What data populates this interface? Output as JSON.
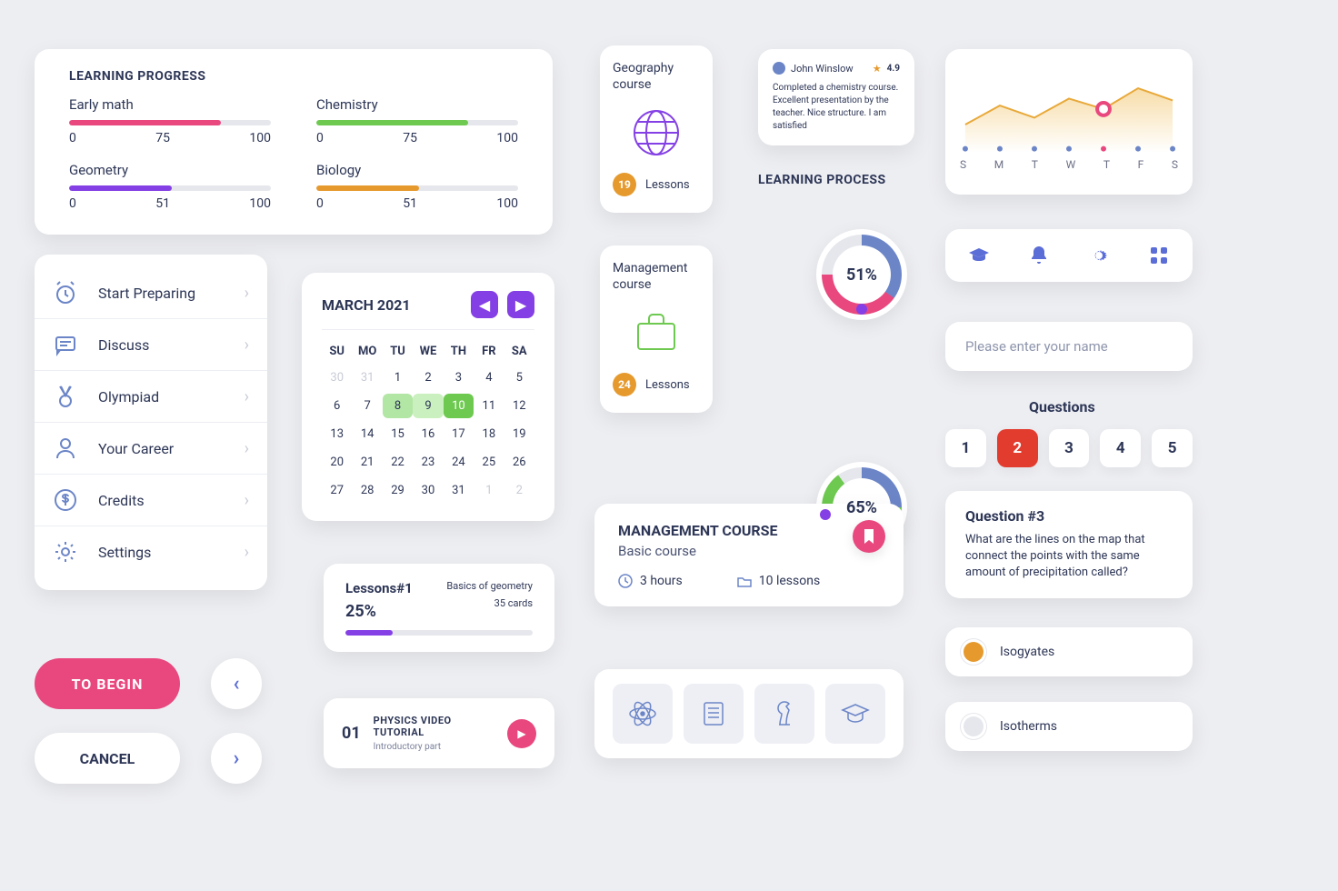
{
  "learning_progress": {
    "title": "LEARNING PROGRESS",
    "items": [
      {
        "label": "Early math",
        "value": 75,
        "min": 0,
        "max": 100,
        "color": "#e8487e"
      },
      {
        "label": "Chemistry",
        "value": 75,
        "min": 0,
        "max": 100,
        "color": "#6dc94f"
      },
      {
        "label": "Geometry",
        "value": 51,
        "min": 0,
        "max": 100,
        "color": "#8440e5"
      },
      {
        "label": "Biology",
        "value": 51,
        "min": 0,
        "max": 100,
        "color": "#e69a2e"
      }
    ]
  },
  "nav": {
    "items": [
      {
        "label": "Start Preparing",
        "icon": "alarm-icon"
      },
      {
        "label": "Discuss",
        "icon": "chat-icon"
      },
      {
        "label": "Olympiad",
        "icon": "medal-icon"
      },
      {
        "label": "Your Career",
        "icon": "person-icon"
      },
      {
        "label": "Credits",
        "icon": "dollar-icon"
      },
      {
        "label": "Settings",
        "icon": "gear-icon"
      }
    ]
  },
  "buttons": {
    "begin": "TO BEGIN",
    "cancel": "CANCEL"
  },
  "calendar": {
    "title": "MARCH 2021",
    "dow": [
      "SU",
      "MO",
      "TU",
      "WE",
      "TH",
      "FR",
      "SA"
    ],
    "prev_month": [
      30,
      31
    ],
    "days": [
      1,
      2,
      3,
      4,
      5,
      6,
      7,
      8,
      9,
      10,
      11,
      12,
      13,
      14,
      15,
      16,
      17,
      18,
      19,
      20,
      21,
      22,
      23,
      24,
      25,
      26,
      27,
      28,
      29,
      30,
      31
    ],
    "next_month": [
      1,
      2
    ],
    "selected": [
      8,
      9,
      10
    ]
  },
  "lesson": {
    "name": "Lessons#1",
    "percent": "25%",
    "percent_n": 25,
    "subject": "Basics of geometry",
    "cards": "35 cards",
    "color": "#8440e5"
  },
  "video": {
    "num": "01",
    "title": "PHYSICS VIDEO TUTORIAL",
    "sub": "Introductory part"
  },
  "courses": {
    "geography": {
      "title": "Geography course",
      "count": "19",
      "lessons": "Lessons"
    },
    "management": {
      "title": "Management course",
      "count": "24",
      "lessons": "Lessons"
    }
  },
  "review": {
    "name": "John Winslow",
    "rating": "4.9",
    "text": "Completed a chemistry course. Excellent presentation by the teacher. Nice structure. I am satisfied"
  },
  "process": {
    "title": "LEARNING PROCESS",
    "d1": "51%",
    "d2": "65%"
  },
  "management_course": {
    "title": "MANAGEMENT COURSE",
    "sub": "Basic course",
    "duration": "3 hours",
    "lessons": "10 lessons"
  },
  "chart_data": {
    "type": "area",
    "categories": [
      "S",
      "M",
      "T",
      "W",
      "T",
      "F",
      "S"
    ],
    "values": [
      30,
      52,
      38,
      60,
      48,
      72,
      58
    ],
    "marker_index": 4,
    "ylim": [
      0,
      100
    ]
  },
  "toolbar": {
    "icons": [
      "graduation-icon",
      "bell-icon",
      "gear-icon",
      "grid-icon"
    ]
  },
  "name_input": {
    "placeholder": "Please enter your name"
  },
  "questions": {
    "title": "Questions",
    "numbers": [
      "1",
      "2",
      "3",
      "4",
      "5"
    ],
    "active": 2,
    "card_title": "Question #3",
    "card_text": "What are the lines on the map that connect the points with the same amount of precipitation called?",
    "answers": [
      "Isogyates",
      "Isotherms"
    ]
  },
  "iconrow": [
    "atom-icon",
    "book-icon",
    "chess-icon",
    "graduation-icon"
  ]
}
